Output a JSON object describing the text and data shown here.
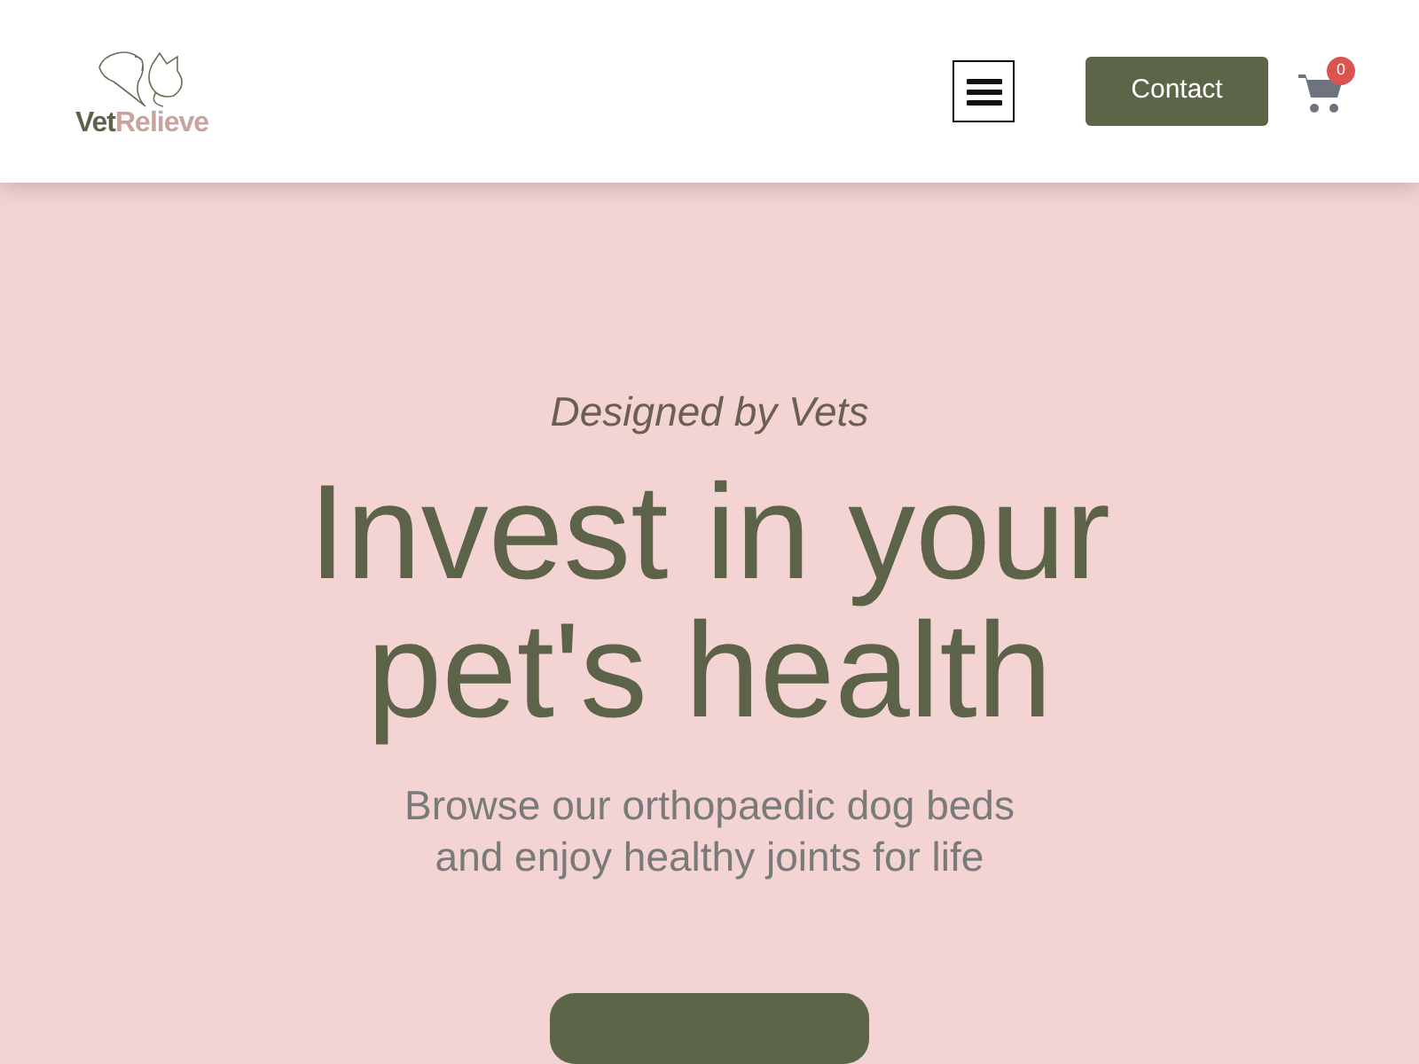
{
  "header": {
    "logo": {
      "parts": [
        "Vet",
        "Relieve"
      ]
    },
    "contact_button": "Contact",
    "cart_count": "0"
  },
  "hero": {
    "eyebrow": "Designed by Vets",
    "title_lines": [
      "Invest in your",
      "pet's health"
    ],
    "subtitle_lines": [
      "Browse our orthopaedic dog beds",
      "and enjoy healthy joints for life"
    ],
    "cta": {
      "kind": "button"
    }
  }
}
